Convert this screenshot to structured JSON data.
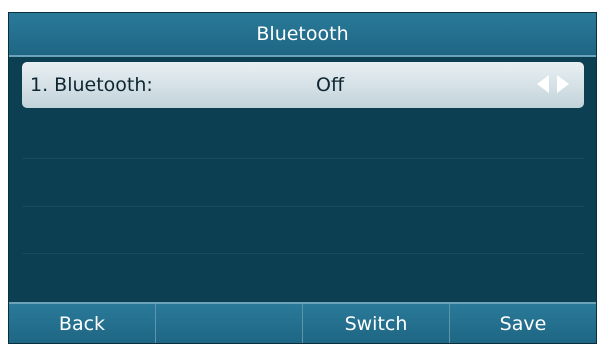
{
  "title": "Bluetooth",
  "items": [
    {
      "label": "1. Bluetooth:",
      "value": "Off"
    }
  ],
  "icons": {
    "prev": "triangle-left-icon",
    "next": "triangle-right-icon"
  },
  "softkeys": [
    "Back",
    "",
    "Switch",
    "Save"
  ],
  "colors": {
    "screen_bg": "#0d3f52",
    "bar_bg": "#2a7a99",
    "selected_bg": "#d9e4e9",
    "text_light": "#ffffff",
    "text_dark": "#0e2630"
  }
}
